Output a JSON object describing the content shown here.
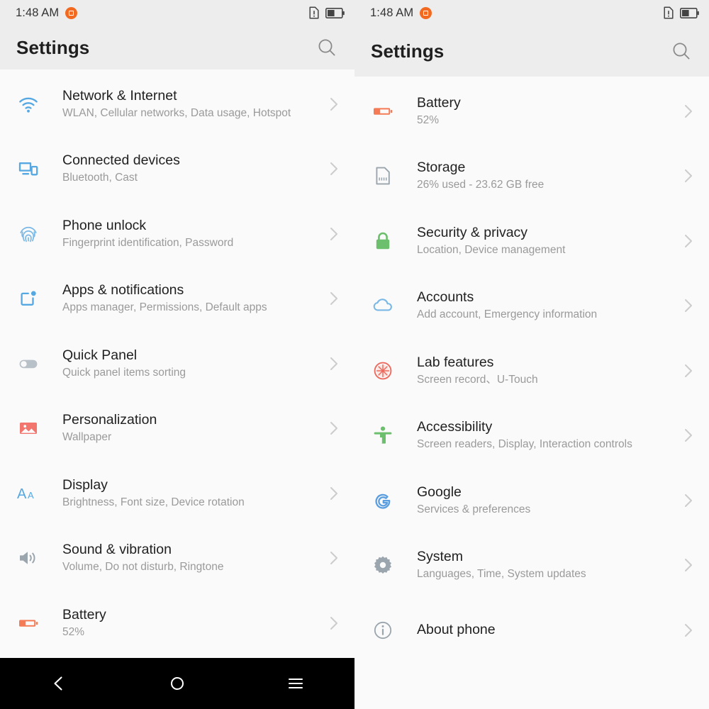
{
  "status_bar": {
    "time": "1:48 AM",
    "badge_icon": "stop-recording-badge-icon",
    "sim_icon": "sim-card-alert-icon",
    "battery_icon": "battery-half-icon"
  },
  "colors": {
    "header_bg": "#ededed",
    "body_bg": "#fafafa",
    "title": "#1f1f1f",
    "subtitle": "#9a9a9a",
    "accent_blue": "#55a8e2",
    "accent_orange": "#f47b55",
    "accent_green": "#6cbf6c",
    "accent_gray": "#9aa5ad",
    "badge_orange": "#f26a21",
    "nav_bg": "#000000"
  },
  "left_panel": {
    "app_bar": {
      "title": "Settings",
      "search_icon": "search-icon"
    },
    "items": [
      {
        "title": "Network & Internet",
        "subtitle": "WLAN, Cellular networks, Data usage, Hotspot",
        "icon": "wifi-icon",
        "chevron": "chevron-right-icon"
      },
      {
        "title": "Connected devices",
        "subtitle": "Bluetooth, Cast",
        "icon": "connected-devices-icon",
        "chevron": "chevron-right-icon"
      },
      {
        "title": "Phone unlock",
        "subtitle": "Fingerprint identification, Password",
        "icon": "fingerprint-icon",
        "chevron": "chevron-right-icon"
      },
      {
        "title": "Apps & notifications",
        "subtitle": "Apps manager, Permissions, Default apps",
        "icon": "apps-notifications-icon",
        "chevron": "chevron-right-icon"
      },
      {
        "title": "Quick Panel",
        "subtitle": "Quick panel items sorting",
        "icon": "toggle-switch-icon",
        "chevron": "chevron-right-icon"
      },
      {
        "title": "Personalization",
        "subtitle": "Wallpaper",
        "icon": "image-icon",
        "chevron": "chevron-right-icon"
      },
      {
        "title": "Display",
        "subtitle": "Brightness, Font size, Device rotation",
        "icon": "font-size-aa-icon",
        "chevron": "chevron-right-icon"
      },
      {
        "title": "Sound & vibration",
        "subtitle": "Volume, Do not disturb, Ringtone",
        "icon": "speaker-volume-icon",
        "chevron": "chevron-right-icon"
      },
      {
        "title": "Battery",
        "subtitle": "52%",
        "icon": "battery-icon",
        "chevron": "chevron-right-icon"
      }
    ],
    "nav_bar": {
      "back": "back-chevron-icon",
      "home": "home-circle-icon",
      "recents": "recents-menu-icon"
    }
  },
  "right_panel": {
    "app_bar": {
      "title": "Settings",
      "search_icon": "search-icon"
    },
    "items": [
      {
        "title": "Battery",
        "subtitle": "52%",
        "icon": "battery-icon",
        "chevron": "chevron-right-icon"
      },
      {
        "title": "Storage",
        "subtitle": "26% used - 23.62 GB free",
        "icon": "storage-card-icon",
        "chevron": "chevron-right-icon"
      },
      {
        "title": "Security & privacy",
        "subtitle": "Location, Device management",
        "icon": "lock-icon",
        "chevron": "chevron-right-icon"
      },
      {
        "title": "Accounts",
        "subtitle": "Add account, Emergency information",
        "icon": "cloud-icon",
        "chevron": "chevron-right-icon"
      },
      {
        "title": "Lab features",
        "subtitle": "Screen record、U-Touch",
        "icon": "citrus-slice-icon",
        "chevron": "chevron-right-icon"
      },
      {
        "title": "Accessibility",
        "subtitle": "Screen readers, Display, Interaction controls",
        "icon": "accessibility-person-icon",
        "chevron": "chevron-right-icon"
      },
      {
        "title": "Google",
        "subtitle": "Services & preferences",
        "icon": "google-g-icon",
        "chevron": "chevron-right-icon"
      },
      {
        "title": "System",
        "subtitle": "Languages, Time, System updates",
        "icon": "gear-icon",
        "chevron": "chevron-right-icon"
      },
      {
        "title": "About phone",
        "subtitle": "",
        "icon": "info-circle-icon",
        "chevron": "chevron-right-icon"
      }
    ]
  }
}
